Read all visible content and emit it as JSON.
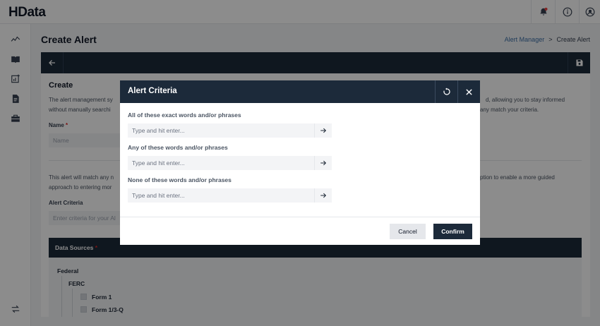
{
  "app": {
    "logo": "HData"
  },
  "header": {
    "icons": [
      "notification-bell-icon",
      "info-icon",
      "user-account-icon"
    ]
  },
  "sidebar": {
    "icons": [
      "activity-icon",
      "book-icon",
      "chart-add-icon",
      "document-icon",
      "briefcase-icon",
      "swap-icon"
    ]
  },
  "page": {
    "title": "Create Alert",
    "breadcrumb": {
      "link": "Alert Manager",
      "separator": ">",
      "current": "Create Alert"
    }
  },
  "form": {
    "section_title": "Create",
    "intro_left_1": "The alert management sy",
    "intro_right_1": "d, allowing you to stay informed",
    "intro_left_2": "without manually searchi",
    "intro_right_2": "any match your criteria.",
    "name_label": "Name",
    "required_mark": "*",
    "name_placeholder": "Name",
    "match_left_1": "This alert will match any n",
    "match_right_1": "ption to enable a more guided",
    "match_left_2": "approach to entering mor",
    "criteria_label": "Alert Criteria",
    "criteria_placeholder": "Enter criteria for your Al",
    "data_sources_label": "Data Sources",
    "tree": {
      "federal": "Federal",
      "ferc": "FERC",
      "form1": "Form 1",
      "form13q": "Form 1/3-Q"
    }
  },
  "modal": {
    "title": "Alert Criteria",
    "fields": [
      {
        "label": "All of these exact words and/or phrases",
        "placeholder": "Type and hit enter..."
      },
      {
        "label": "Any of these words and/or phrases",
        "placeholder": "Type and hit enter..."
      },
      {
        "label": "None of these words and/or phrases",
        "placeholder": "Type and hit enter..."
      }
    ],
    "cancel_label": "Cancel",
    "confirm_label": "Confirm"
  },
  "colors": {
    "dark_navy": "#1c2a3a",
    "link_blue": "#3b6ea5",
    "notification_dot": "#ef4444",
    "required_red": "#dc2626"
  }
}
